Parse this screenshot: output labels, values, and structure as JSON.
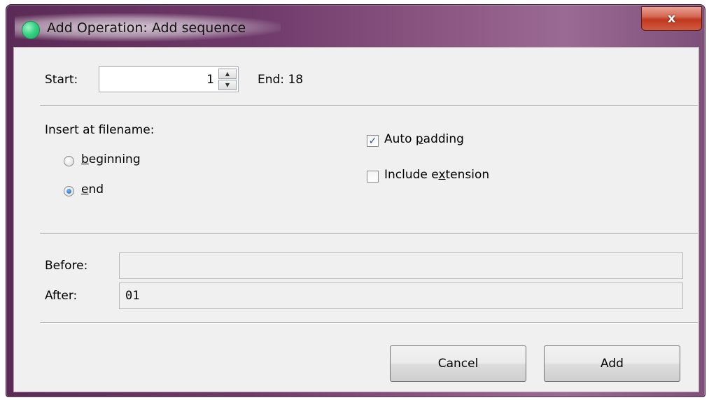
{
  "window": {
    "title": "Add Operation: Add sequence",
    "close_glyph": "x"
  },
  "range": {
    "start_label": "Start:",
    "start_value": "1",
    "end_label": "End:",
    "end_value": "18"
  },
  "insert": {
    "heading": "Insert at filename:",
    "options": [
      {
        "pre": "",
        "ul": "b",
        "post": "eginning",
        "selected": false
      },
      {
        "pre": "",
        "ul": "e",
        "post": "nd",
        "selected": true
      }
    ]
  },
  "options": {
    "auto_padding": {
      "pre": "Auto ",
      "ul": "p",
      "post": "adding",
      "checked": true
    },
    "include_extension": {
      "pre": "Include e",
      "ul": "x",
      "post": "tension",
      "checked": false
    }
  },
  "preview": {
    "before_label": "Before:",
    "before_value": "",
    "after_label": "After:",
    "after_value": "01"
  },
  "buttons": {
    "cancel": "Cancel",
    "add": "Add"
  },
  "colors": {
    "accent_check": "#2b50a6",
    "close_button": "#c0391f",
    "app_icon": "#38d486"
  },
  "icons": {
    "app": "app-icon",
    "close": "close-icon",
    "spin_up": "spin-up-icon",
    "spin_down": "spin-down-icon",
    "checkmark": "checkmark-icon"
  }
}
